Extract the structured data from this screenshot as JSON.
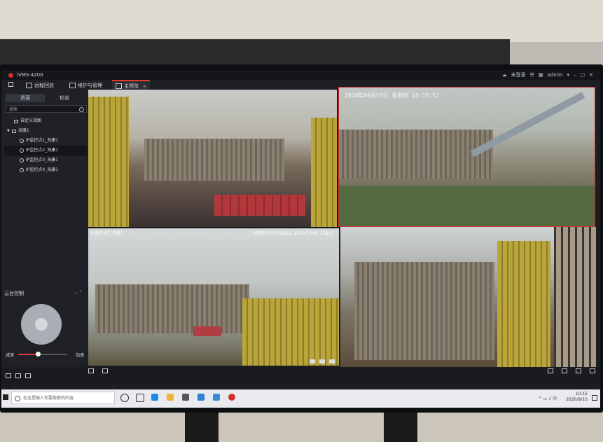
{
  "app": {
    "title": "iVMS-4200",
    "login_status": "未登录",
    "user": "admin"
  },
  "tabs": [
    {
      "label": "远程回放"
    },
    {
      "label": "维护与管理"
    },
    {
      "label": "主预览"
    }
  ],
  "panel": {
    "subtabs": [
      "资源",
      "轮巡"
    ],
    "search_placeholder": "搜索",
    "tree": [
      {
        "label": "自定义视图"
      },
      {
        "label": "海康1"
      },
      {
        "label": "IP监控点1_海康1"
      },
      {
        "label": "IP监控点2_海康1"
      },
      {
        "label": "IP监控点3_海康1"
      },
      {
        "label": "IP监控点4_海康1"
      }
    ]
  },
  "ptz": {
    "title": "云台控制",
    "speed_low": "减速",
    "speed_high": "加速",
    "speed_level": 0.4
  },
  "videos": {
    "v2_timestamp": "2020年09月10日  星期四  10:15:52",
    "v3_label": "IP监控点3_海康1",
    "v3_stream": "主码流(535.95kbps, 2560*1440, 25fps)"
  },
  "taskbar": {
    "search_placeholder": "在这里输入你要搜索的内容",
    "time": "10:15",
    "date": "2020/9/10"
  },
  "colors": {
    "accent": "#e53935",
    "panel": "#202127",
    "screen": "#1c1d21"
  }
}
